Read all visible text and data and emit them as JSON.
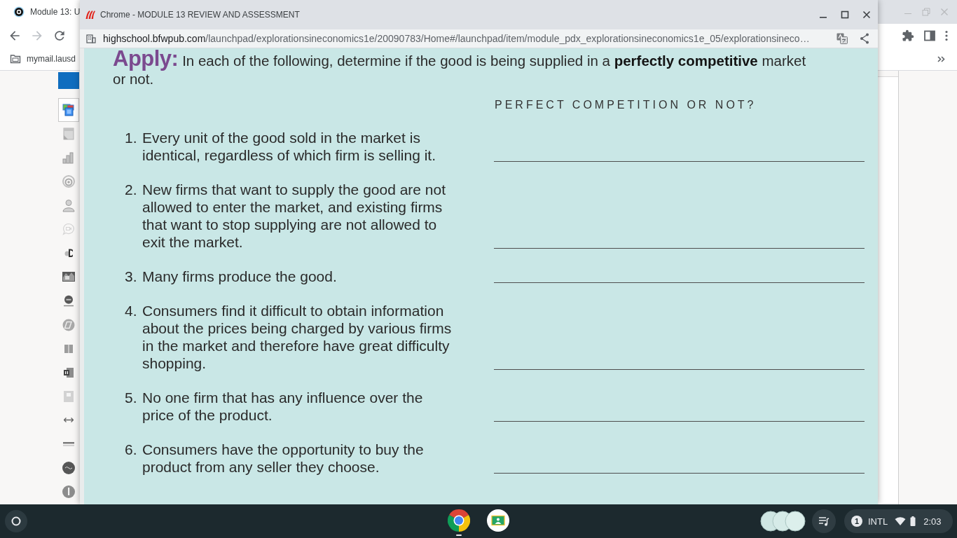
{
  "background_window": {
    "tab": {
      "title": "Module 13: U"
    },
    "bookmarks_bar": {
      "items": [
        {
          "label": "mymail.lausd"
        }
      ]
    },
    "sidebar": {
      "items": [
        {
          "kind": "windows",
          "selected": true
        },
        {
          "kind": "document",
          "selected": false
        },
        {
          "kind": "chart",
          "selected": false
        },
        {
          "kind": "ring",
          "selected": false
        },
        {
          "kind": "person",
          "selected": false
        },
        {
          "kind": "chat",
          "selected": false
        },
        {
          "kind": "dots",
          "selected": false
        },
        {
          "kind": "photo",
          "selected": false
        },
        {
          "kind": "badge",
          "selected": false
        },
        {
          "kind": "swirl",
          "selected": false
        },
        {
          "kind": "book",
          "selected": false
        },
        {
          "kind": "notebook",
          "selected": false
        },
        {
          "kind": "tile",
          "selected": false
        },
        {
          "kind": "arrows",
          "selected": false
        },
        {
          "kind": "wordmark",
          "selected": false
        },
        {
          "kind": "pill",
          "selected": false
        },
        {
          "kind": "disc",
          "selected": false
        }
      ]
    }
  },
  "popup_window": {
    "title": "Chrome - MODULE 13 REVIEW AND ASSESSMENT",
    "url": {
      "host": "highschool.bfwpub.com",
      "path": "/launchpad/explorationsineconomics1e/20090783/Home#/launchpad/item/module_pdx_explorationsineconomics1e_05/explorationsineco…"
    },
    "worksheet": {
      "instructions": "**Apply:** In each of the following, determine if the good is being supplied in a **perfectly competitive** market or not.",
      "answer_heading": "PERFECT COMPETITION OR NOT?",
      "items": [
        {
          "number": "1.",
          "text": "Every unit of the good sold in the market is identical, regardless of which firm is selling it."
        },
        {
          "number": "2.",
          "text": "New firms that want to supply the good are not allowed to enter the market, and existing firms that want to stop supplying are not allowed to exit the market."
        },
        {
          "number": "3.",
          "text": "Many firms produce the good."
        },
        {
          "number": "4.",
          "text": "Consumers find it difficult to obtain information about the prices being charged by various firms in the market and therefore have great difficulty shopping."
        },
        {
          "number": "5.",
          "text": "No one firm that has any influence over the price of the product."
        },
        {
          "number": "6.",
          "text": "Consumers have the opportunity to buy the product from any seller they choose."
        }
      ]
    }
  },
  "shelf": {
    "apps": [
      {
        "kind": "chrome",
        "running": true
      },
      {
        "kind": "classroom",
        "running": false
      }
    ],
    "notification_count": "1",
    "input_method": "INTL",
    "time": "2:03"
  }
}
